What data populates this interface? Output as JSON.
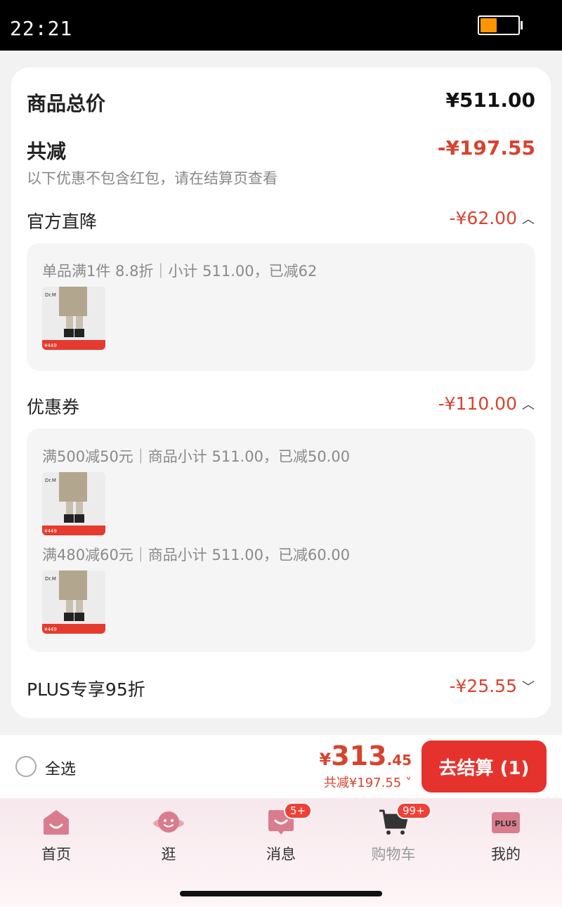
{
  "status": {
    "time": "22:21",
    "battery_level": 0.45
  },
  "summary": {
    "total_label": "商品总价",
    "total_value": "¥511.00",
    "reduce_label": "共减",
    "reduce_value": "-¥197.55",
    "note": "以下优惠不包含红包，请在结算页查看"
  },
  "official": {
    "label": "官方直降",
    "value": "-¥62.00",
    "detail": "单品满1件 8.8折｜小计 511.00，已减62"
  },
  "coupon": {
    "label": "优惠券",
    "value": "-¥110.00",
    "detail_1": "满500减50元｜商品小计 511.00，已减50.00",
    "detail_2": "满480减60元｜商品小计 511.00，已减60.00"
  },
  "plus": {
    "label": "PLUS专享95折",
    "value": "-¥25.55"
  },
  "thumb": {
    "price_tag": "¥449"
  },
  "bottom": {
    "select_all": "全选",
    "currency": "¥",
    "amount_int": "313",
    "amount_dec": ".45",
    "saved": "共减¥197.55",
    "checkout": "去结算 (1)"
  },
  "tabs": [
    {
      "label": "首页",
      "icon": "home-icon"
    },
    {
      "label": "逛",
      "icon": "planet-icon"
    },
    {
      "label": "消息",
      "icon": "message-icon",
      "badge": "5+"
    },
    {
      "label": "购物车",
      "icon": "cart-icon",
      "badge": "99+"
    },
    {
      "label": "我的",
      "icon": "plus-icon",
      "icon_text": "PLUS"
    }
  ],
  "colors": {
    "accent": "#e6322c",
    "discount": "#d8432e"
  }
}
